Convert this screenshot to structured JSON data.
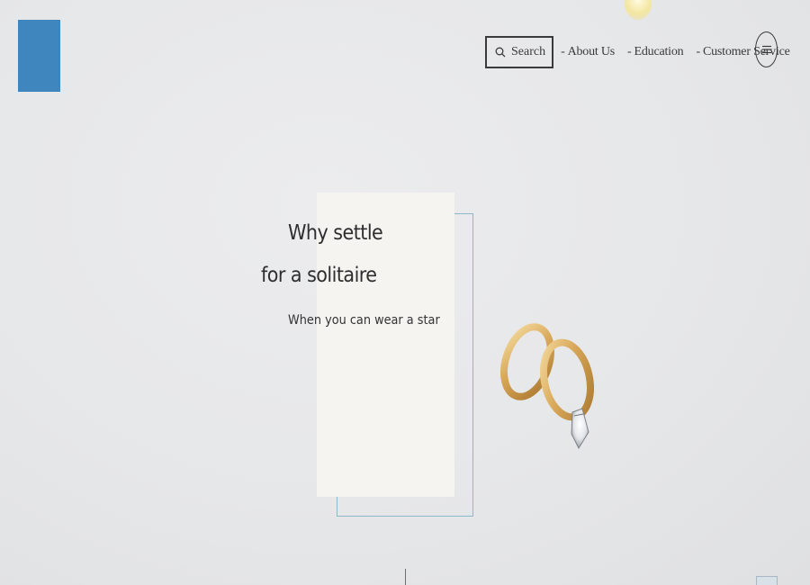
{
  "header": {
    "search_label": "Search",
    "nav_items": [
      {
        "label": "About Us"
      },
      {
        "label": "Education"
      },
      {
        "label": "Customer Service"
      }
    ],
    "nav_separator": "-",
    "menu_icon": "hamburger-icon",
    "logo_color": "#3f86bf"
  },
  "hero": {
    "headline_line1": "Why settle",
    "headline_line2": "for a solitaire",
    "subheadline": "When you can wear a star",
    "card_color": "#f5f4f1",
    "outline_color": "#8fb7c8"
  }
}
